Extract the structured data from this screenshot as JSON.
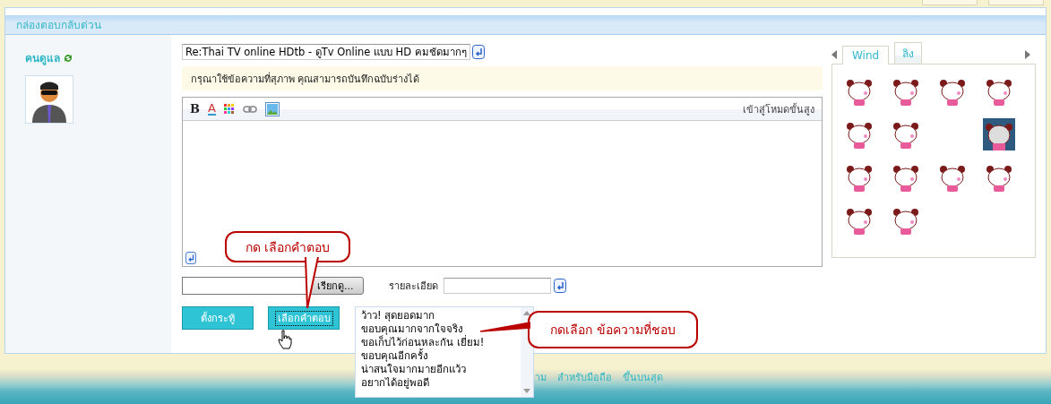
{
  "panel": {
    "title": "กล่องตอบกลับด่วน"
  },
  "user": {
    "name": "คนดูแล"
  },
  "subject": {
    "value": "Re:Thai TV online HDtb - ดูTv Online แบบ HD คมชัดมากๆ"
  },
  "notice": "กรุณาใช้ข้อความที่สุภาพ คุณสามารถบันทึกฉบับร่างได้",
  "editor": {
    "toolbar": [
      {
        "kind": "bold",
        "label": "B"
      },
      {
        "kind": "color",
        "label": "A"
      },
      {
        "kind": "palette"
      },
      {
        "kind": "link"
      },
      {
        "kind": "image"
      }
    ],
    "advanced_link": "เข้าสู่โหมดขั้นสูง"
  },
  "attachment": {
    "browse_button": "เรียกดู...",
    "detail_label": "รายละเอียด"
  },
  "buttons": [
    {
      "label": "ตั้งกระทู้",
      "focused": false
    },
    {
      "label": "เลือกคำตอบ",
      "focused": true
    }
  ],
  "reply_list": [
    "ว้าว! สุดยอดมาก",
    "ขอบคุณมากจากใจจริง",
    "ขอเก็บไว้ก่อนหละกัน เยี่ยม!",
    "ขอบคุณอีกครั้ง",
    "น่าสนใจมากมายอีกแว้ว",
    "อยากได้อยู่พอดี"
  ],
  "callouts": [
    {
      "text": "กด เลือกคำตอบ"
    },
    {
      "text": "กดเลือก ข้อความที่ชอบ"
    }
  ],
  "emoticons": {
    "tabs": [
      {
        "label": "Wind",
        "selected": true
      },
      {
        "label": "ลิง",
        "selected": false
      }
    ],
    "rows": [
      [
        {
          "kind": "panda"
        },
        {
          "kind": "panda"
        },
        {
          "kind": "panda"
        },
        {
          "kind": "panda"
        }
      ],
      [
        {
          "kind": "panda"
        },
        {
          "kind": "panda"
        },
        {
          "kind": "blank"
        },
        {
          "kind": "photo"
        }
      ],
      [
        {
          "kind": "panda"
        },
        {
          "kind": "panda"
        },
        {
          "kind": "panda"
        },
        {
          "kind": "panda"
        }
      ],
      [
        {
          "kind": "panda"
        },
        {
          "kind": "panda"
        }
      ]
    ]
  },
  "footer_links": [
    "าม",
    "สำหรับมือถือ",
    "ขึ้นบนสุด"
  ]
}
